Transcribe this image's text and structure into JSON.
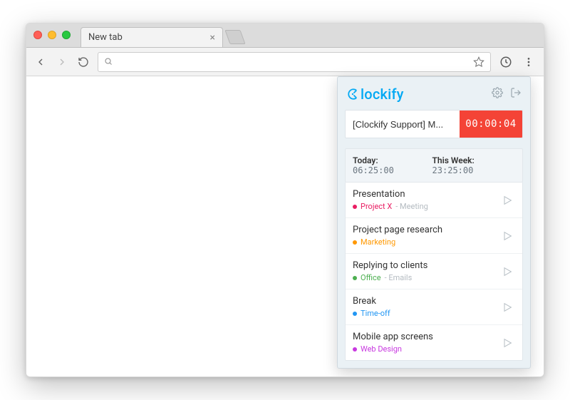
{
  "browser": {
    "tab_title": "New tab",
    "omnibox_placeholder": ""
  },
  "clockify": {
    "brand": "lockify",
    "timer": {
      "description": "[Clockify Support] M...",
      "elapsed": "00:00:04"
    },
    "summary": {
      "today_label": "Today:",
      "today_value": "06:25:00",
      "week_label": "This Week:",
      "week_value": "23:25:00"
    },
    "entries": [
      {
        "title": "Presentation",
        "project": "Project X",
        "client": "Meeting",
        "color": "#e91e63"
      },
      {
        "title": "Project page research",
        "project": "Marketing",
        "client": "",
        "color": "#ff9800"
      },
      {
        "title": "Replying to clients",
        "project": "Office",
        "client": "Emails",
        "color": "#4caf50"
      },
      {
        "title": "Break",
        "project": "Time-off",
        "client": "",
        "color": "#2196f3"
      },
      {
        "title": "Mobile app screens",
        "project": "Web Design",
        "client": "",
        "color": "#c838e0"
      }
    ]
  }
}
